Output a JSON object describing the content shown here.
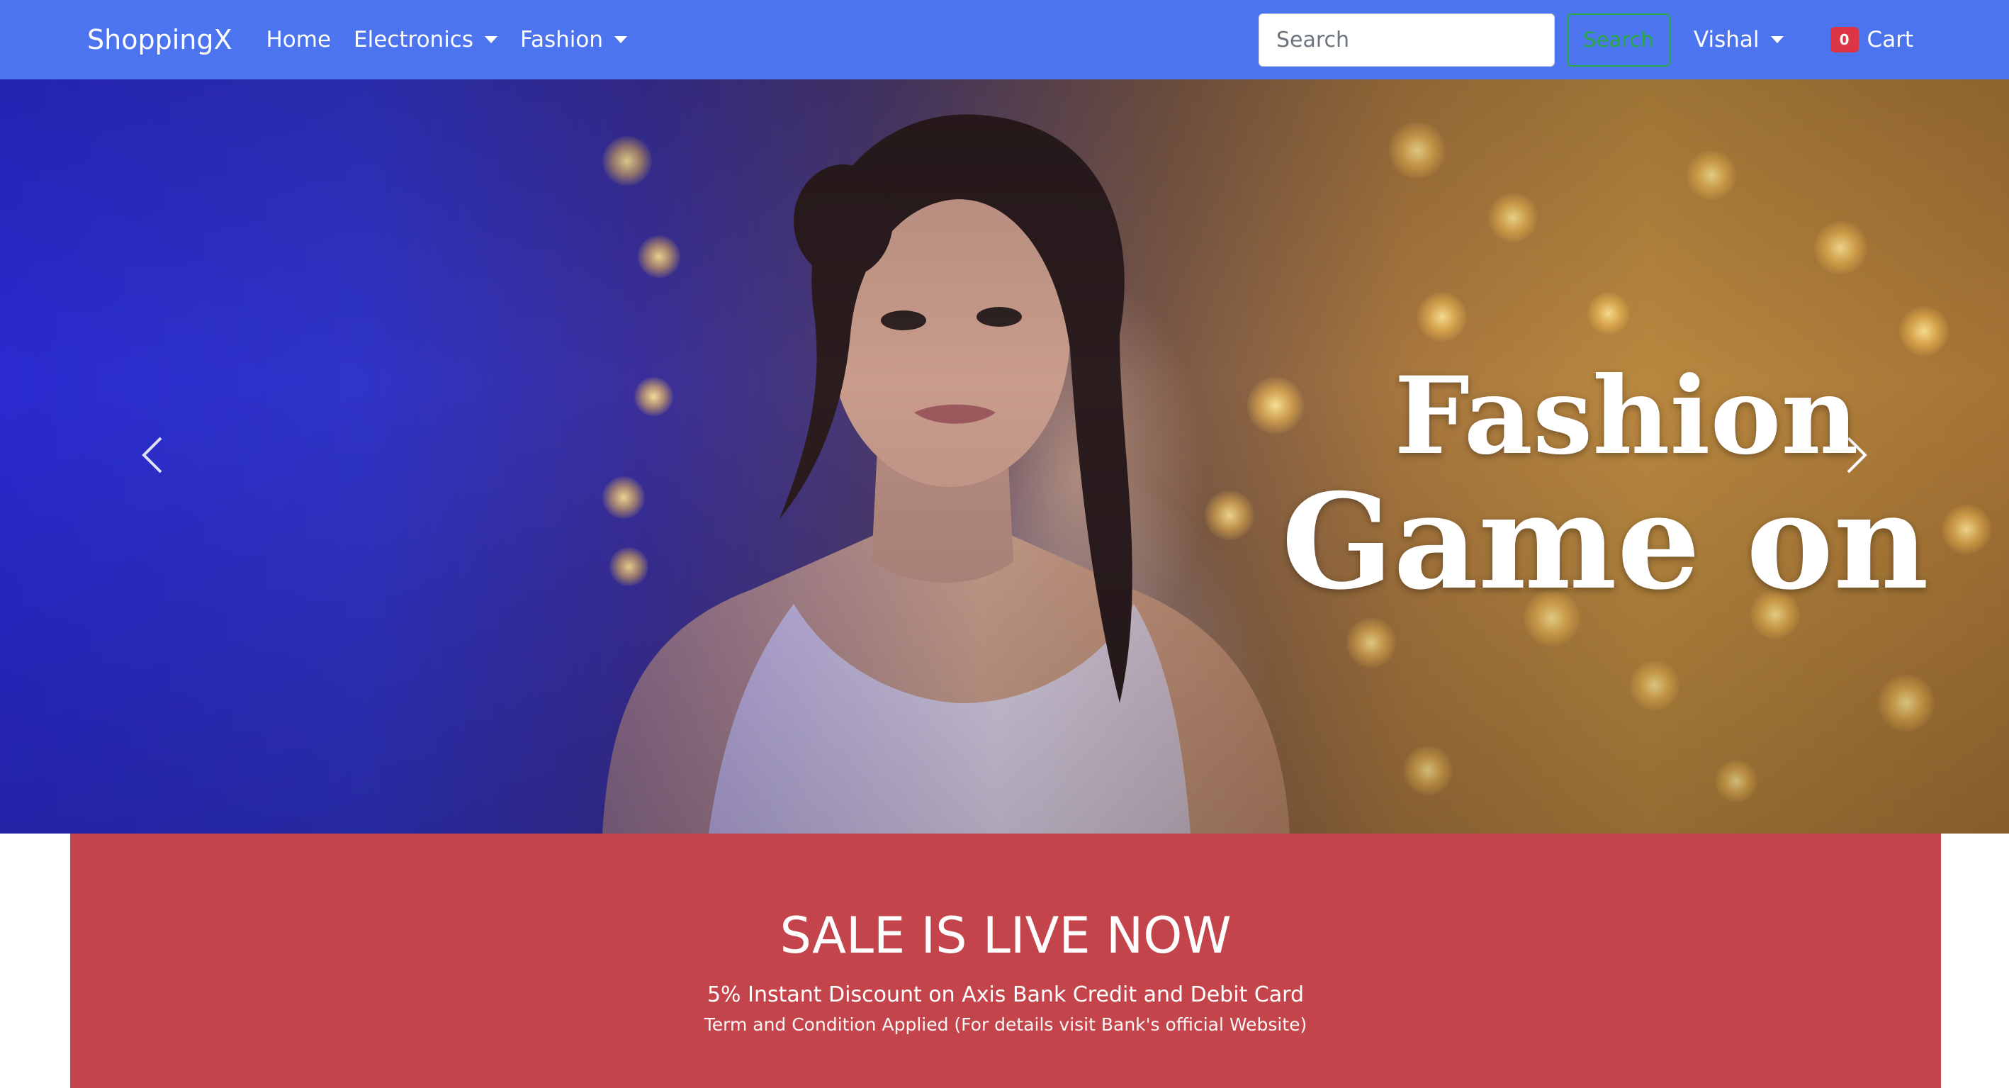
{
  "navbar": {
    "brand": "ShoppingX",
    "links": [
      {
        "label": "Home"
      },
      {
        "label": "Electronics"
      },
      {
        "label": "Fashion"
      }
    ],
    "search": {
      "placeholder": "Search",
      "value": "",
      "button_label": "Search"
    },
    "user": {
      "name": "Vishal"
    },
    "cart": {
      "count": "0",
      "label": "Cart"
    },
    "colors": {
      "background": "#4c74ee",
      "search_button": "#28a745",
      "badge": "#dc3545"
    }
  },
  "hero": {
    "caption_line1": "Fashion",
    "caption_line2": "Game on",
    "prev_icon": "chevron-left-icon",
    "next_icon": "chevron-right-icon"
  },
  "sale": {
    "title": "SALE IS LIVE NOW",
    "subtitle": "5% Instant Discount on Axis Bank Credit and Debit Card",
    "terms": "Term and Condition Applied (For details visit Bank's official Website)",
    "color": "#c4444b"
  }
}
